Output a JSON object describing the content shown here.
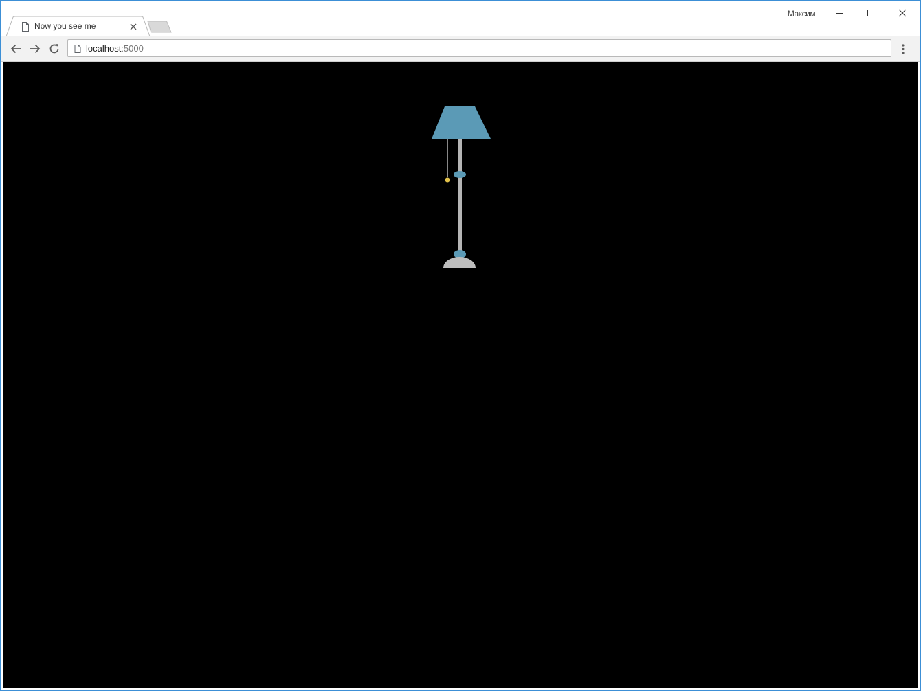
{
  "window": {
    "profile_name": "Максим",
    "controls": {
      "minimize": "minimize-icon",
      "maximize": "maximize-icon",
      "close": "close-icon"
    }
  },
  "tabs": [
    {
      "title": "Now you see me",
      "favicon": "page-icon",
      "close_icon": "close-icon",
      "active": true
    }
  ],
  "toolbar": {
    "back_icon": "arrow-left-icon",
    "forward_icon": "arrow-right-icon",
    "reload_icon": "reload-icon",
    "menu_icon": "kebab-menu-icon"
  },
  "omnibox": {
    "icon": "page-icon",
    "url_host": "localhost",
    "url_port": ":5000"
  },
  "page": {
    "background": "#000000",
    "lamp": {
      "shade_color": "#5b9ab6",
      "pole_color": "#b5b5b5",
      "base_color": "#bdbdbd",
      "joint_color": "#5b9ab6",
      "pull_chain_knob_color": "#e2c14a",
      "state": "off"
    }
  }
}
